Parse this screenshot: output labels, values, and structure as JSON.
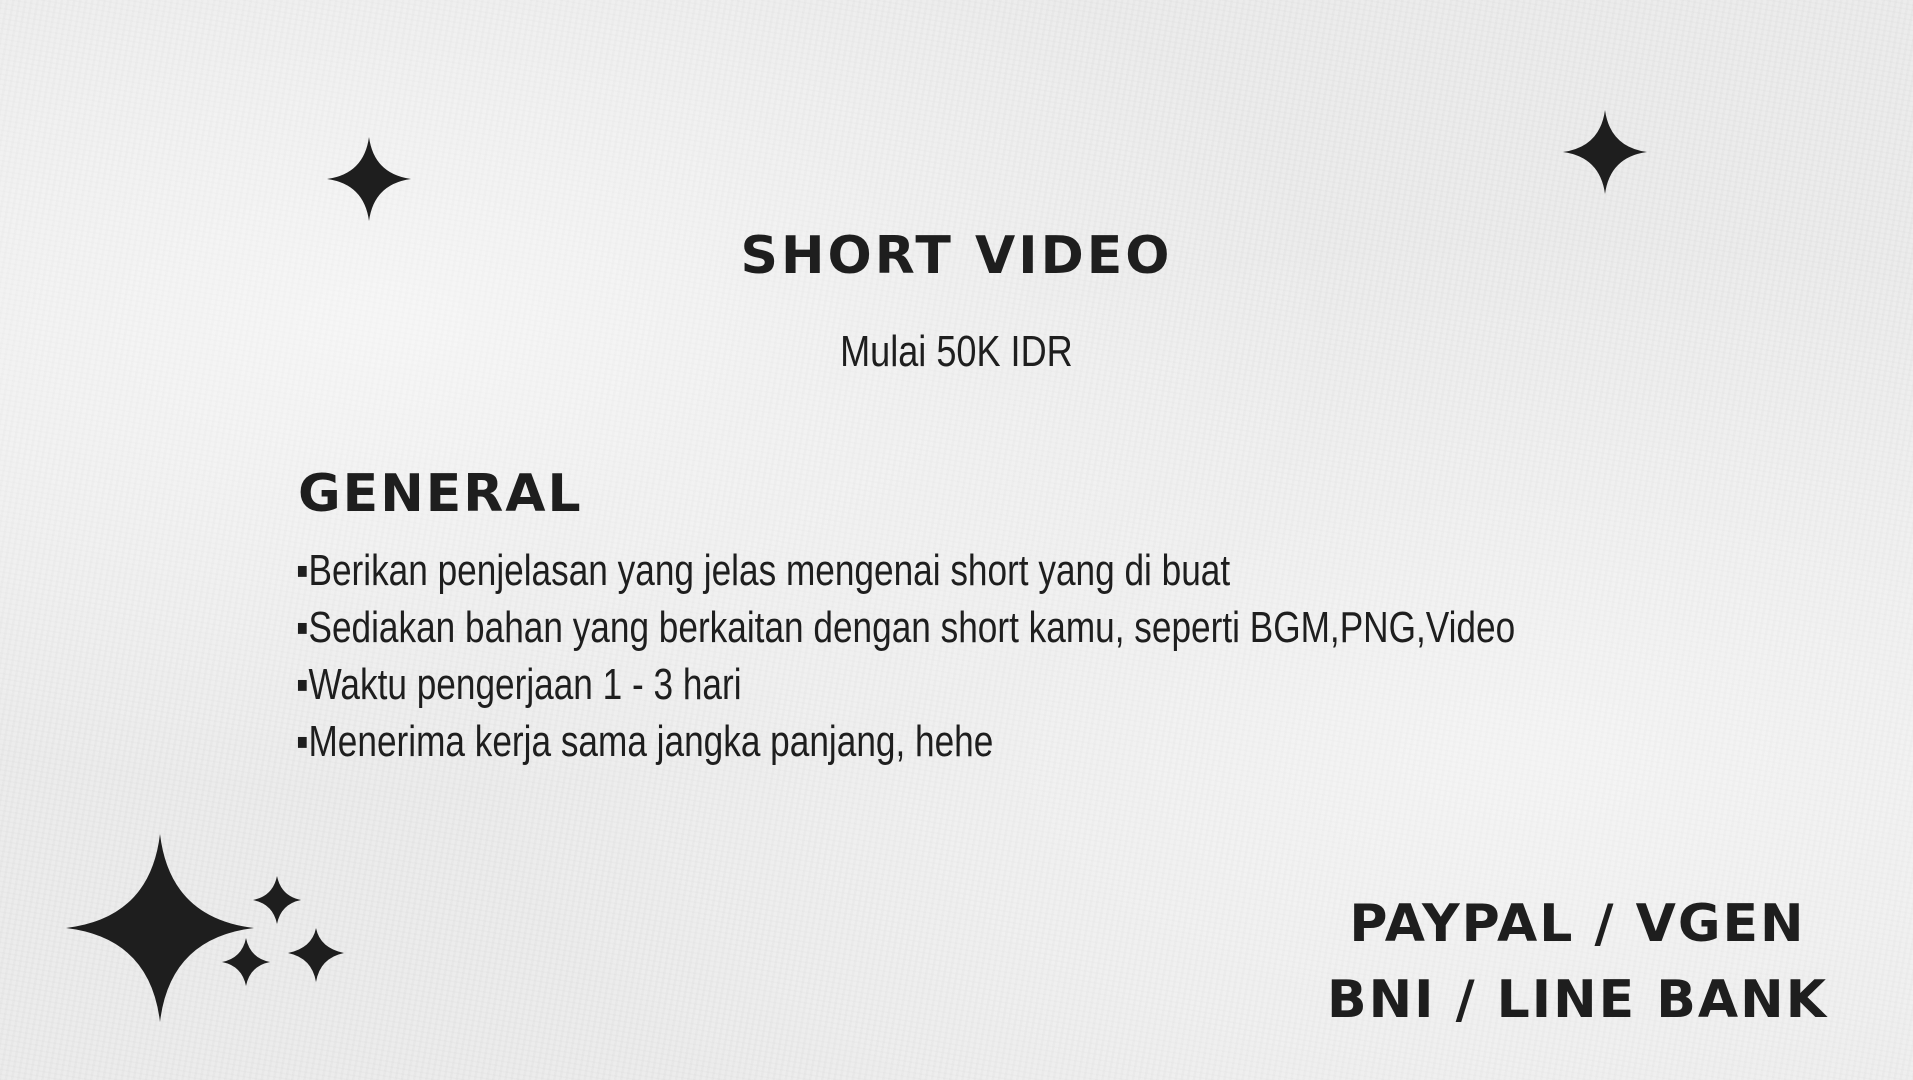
{
  "icons": {
    "top_left": "four-point-star-icon",
    "top_right": "four-point-star-icon",
    "bottom_left_cluster": "sparkles-icon"
  },
  "colors": {
    "text": "#1e1e1e",
    "background": "#ececec"
  },
  "header": {
    "title": "SHORT VIDEO",
    "price": "Mulai 50K IDR"
  },
  "general": {
    "heading": "GENERAL",
    "items": [
      "▪Berikan penjelasan yang jelas mengenai short yang di buat",
      "▪Sediakan bahan yang berkaitan dengan short kamu, seperti BGM,PNG,Video",
      "▪Waktu pengerjaan 1 - 3 hari",
      "▪Menerima kerja sama jangka panjang, hehe"
    ]
  },
  "payment": {
    "line1": "PAYPAL / VGEN",
    "line2": "BNI / LINE BANK"
  }
}
